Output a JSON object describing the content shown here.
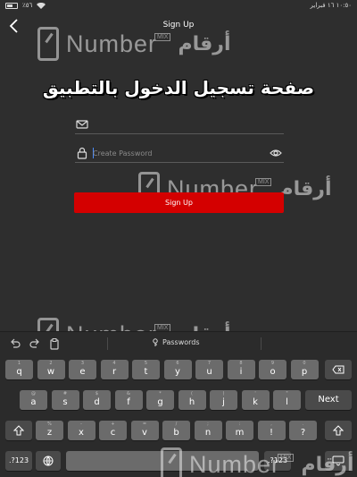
{
  "status_bar": {
    "battery": "٪٥٦",
    "datetime": "١٠:٥٠ ١٦ فبراير"
  },
  "nav": {
    "title": "Sign Up"
  },
  "headline": "صفحة تسجيل الدخول بالتطبيق",
  "form": {
    "email_placeholder": "",
    "password_placeholder": "Create Password",
    "signup_label": "Sign Up"
  },
  "watermark": {
    "word": "Number",
    "mix": "MIX",
    "arabic": "أرقام"
  },
  "keyboard": {
    "suggestion": "Passwords",
    "row1": [
      {
        "main": "q",
        "sub": "1"
      },
      {
        "main": "w",
        "sub": "2"
      },
      {
        "main": "e",
        "sub": "3"
      },
      {
        "main": "r",
        "sub": "4"
      },
      {
        "main": "t",
        "sub": "5"
      },
      {
        "main": "y",
        "sub": "6"
      },
      {
        "main": "u",
        "sub": "7"
      },
      {
        "main": "i",
        "sub": "8"
      },
      {
        "main": "o",
        "sub": "9"
      },
      {
        "main": "p",
        "sub": "0"
      }
    ],
    "row2": [
      {
        "main": "a",
        "sub": "@"
      },
      {
        "main": "s",
        "sub": "#"
      },
      {
        "main": "d",
        "sub": "$"
      },
      {
        "main": "f",
        "sub": "&"
      },
      {
        "main": "g",
        "sub": "*"
      },
      {
        "main": "h",
        "sub": "("
      },
      {
        "main": "j",
        "sub": ")"
      },
      {
        "main": "k",
        "sub": "'"
      },
      {
        "main": "l",
        "sub": "\""
      }
    ],
    "row3": [
      {
        "main": "z",
        "sub": "%"
      },
      {
        "main": "x",
        "sub": "-"
      },
      {
        "main": "c",
        "sub": "+"
      },
      {
        "main": "v",
        "sub": "="
      },
      {
        "main": "b",
        "sub": "/"
      },
      {
        "main": "n",
        "sub": ";"
      },
      {
        "main": "m",
        "sub": ":"
      },
      {
        "main": "!",
        "sub": ","
      },
      {
        "main": "?",
        "sub": "."
      }
    ],
    "next_label": "Next",
    "numbers_label": ".?123"
  },
  "colors": {
    "background": "#2e2e2e",
    "accent": "#d40000"
  }
}
